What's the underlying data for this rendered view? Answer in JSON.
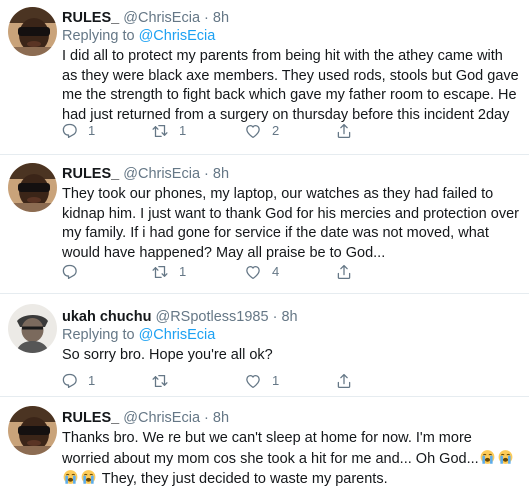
{
  "tweets": [
    {
      "name": "RULES_",
      "handle": "@ChrisEcia",
      "dot": "·",
      "time": "8h",
      "replying_prefix": "Replying to",
      "replying_to": "@ChrisEcia",
      "text": "I did all to protect my parents from being hit with the athey came with as they were black axe members. They used rods, stools but God gave me the strength to fight back which gave my father room to escape. He had just returned from a surgery on thursday before this incident 2day",
      "replies": "1",
      "retweets": "1",
      "likes": "2"
    },
    {
      "name": "RULES_",
      "handle": "@ChrisEcia",
      "dot": "·",
      "time": "8h",
      "text": "They took our phones, my laptop, our watches as they had failed to kidnap him. I just want to thank God for his mercies and protection over my family. If i had gone for service if the date was not moved, what would have happened? May all praise be to God...",
      "replies": "",
      "retweets": "1",
      "likes": "4"
    },
    {
      "name": "ukah chuchu",
      "handle": "@RSpotless1985",
      "dot": "·",
      "time": "8h",
      "replying_prefix": "Replying to",
      "replying_to": "@ChrisEcia",
      "text": "So sorry bro. Hope you're all ok?",
      "replies": "1",
      "retweets": "",
      "likes": "1"
    },
    {
      "name": "RULES_",
      "handle": "@ChrisEcia",
      "dot": "·",
      "time": "8h",
      "text_before": "Thanks bro. We re but we can't sleep at home for now. I'm more worried about my mom cos she took a hit for me and... Oh God...",
      "text_after": " They, they just decided to waste my parents."
    }
  ],
  "icons": {
    "reply": "reply-icon",
    "retweet": "retweet-icon",
    "like": "heart-icon",
    "share": "share-icon",
    "emoji": "loudly-crying-face-emoji"
  },
  "colors": {
    "link": "#1da1f2",
    "muted": "#657786",
    "text": "#14171a",
    "divider": "#e6ecf0"
  }
}
